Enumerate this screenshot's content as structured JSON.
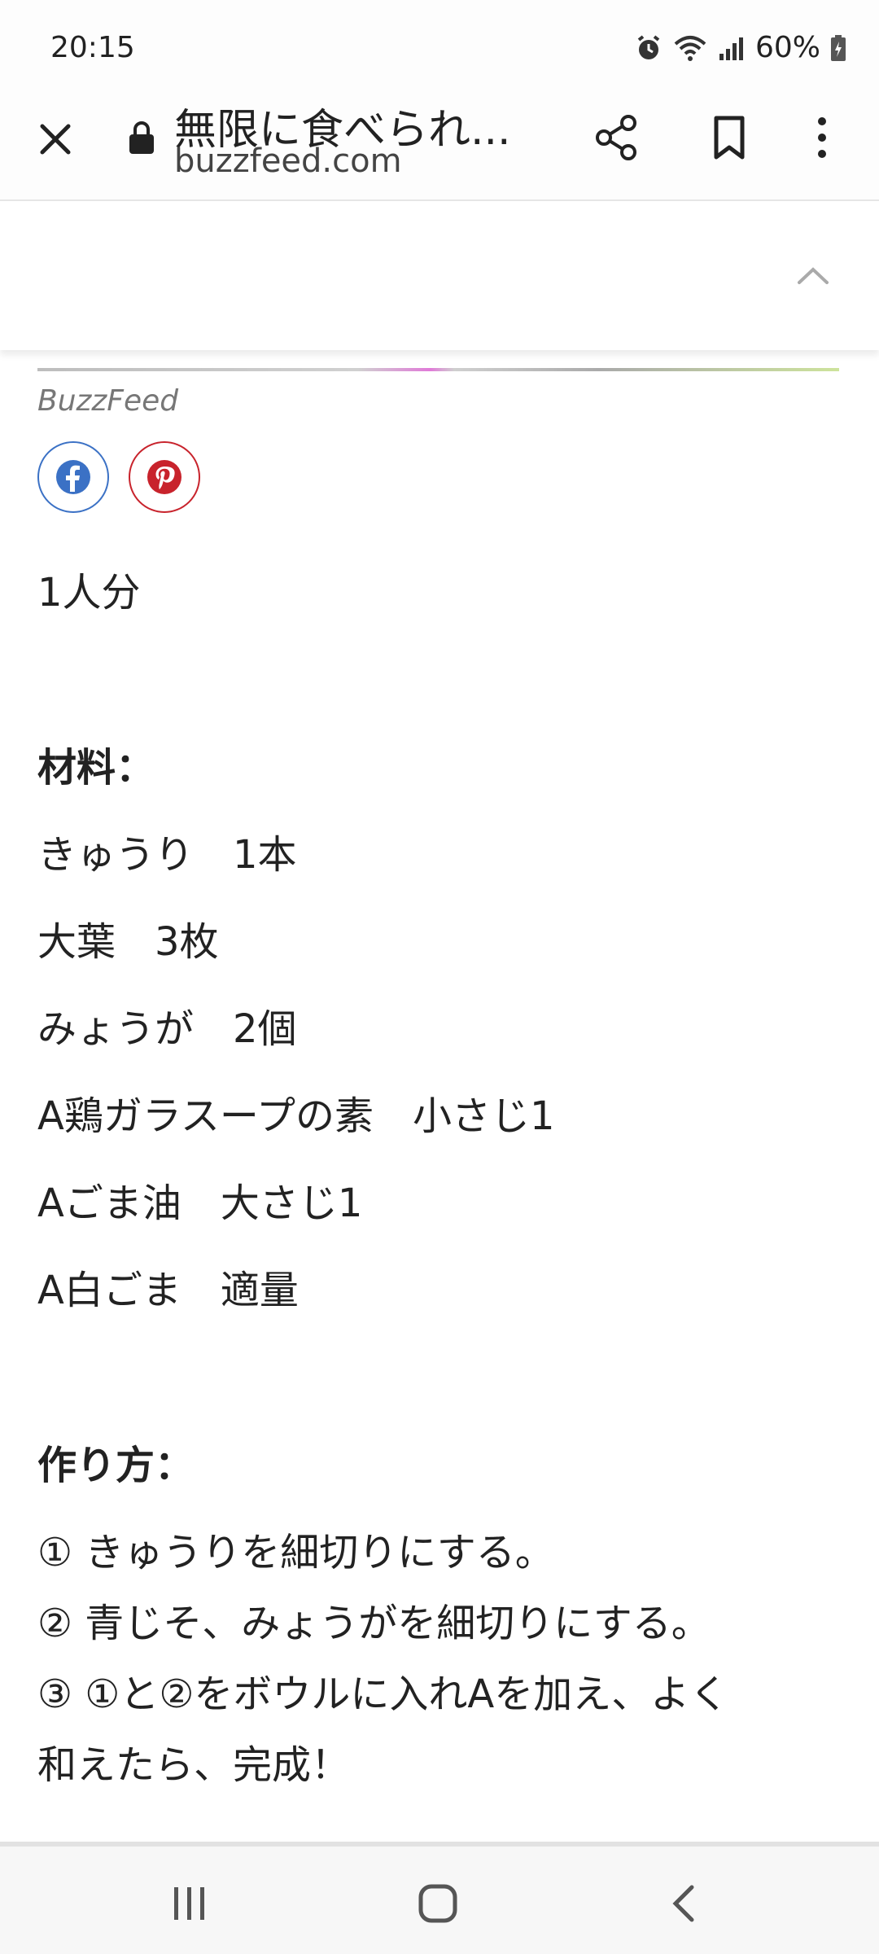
{
  "status_bar": {
    "time": "20:15",
    "battery": "60%"
  },
  "browser": {
    "title": "無限に食べられ...",
    "domain": "buzzfeed.com"
  },
  "article": {
    "credit": "BuzzFeed",
    "servings": "1人分",
    "ingredients_heading": "材料：",
    "ingredients": [
      "きゅうり　1本",
      "大葉　3枚",
      "みょうが　2個",
      "A鶏ガラスープの素　小さじ1",
      "Aごま油　大さじ1",
      "A白ごま　適量"
    ],
    "steps_heading": "作り方：",
    "steps": [
      "① きゅうりを細切りにする。",
      "② 青じそ、みょうがを細切りにする。",
      "③ ①と②をボウルに入れAを加え、よく",
      "和えたら、完成！"
    ]
  },
  "colors": {
    "facebook": "#3b71c5",
    "pinterest": "#c8232c"
  },
  "icons": [
    "alarm-icon",
    "wifi-icon",
    "signal-icon",
    "battery-icon",
    "close-icon",
    "lock-icon",
    "share-icon",
    "bookmark-icon",
    "more-vert-icon",
    "chevron-up-icon",
    "facebook-icon",
    "pinterest-icon",
    "recent-apps-icon",
    "home-icon",
    "back-icon"
  ]
}
